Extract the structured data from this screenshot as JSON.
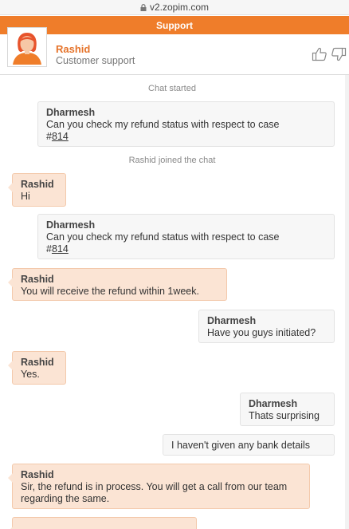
{
  "browser": {
    "url": "v2.zopim.com"
  },
  "header": {
    "title": "Support"
  },
  "agent": {
    "name": "Rashid",
    "role": "Customer support"
  },
  "chat": {
    "system": [
      "Chat started",
      "Rashid joined the chat"
    ],
    "messages": [
      {
        "sender": "Dharmesh",
        "text": "Can you check my refund status with respect to case",
        "line2_prefix": "#",
        "ref": "814"
      },
      {
        "sender": "Rashid",
        "text": "Hi"
      },
      {
        "sender": "Dharmesh",
        "text": "Can you check my refund status with respect to case",
        "line2_prefix": "#",
        "ref": "814"
      },
      {
        "sender": "Rashid",
        "text": "You will receive the refund within 1week."
      },
      {
        "sender": "Dharmesh",
        "text": "Have you guys initiated?"
      },
      {
        "sender": "Rashid",
        "text": "Yes."
      },
      {
        "sender": "Dharmesh",
        "text": "Thats surprising"
      },
      {
        "text": "I haven't given any bank details"
      },
      {
        "sender": "Rashid",
        "text": "Sir, the refund is in process. You will get a call from our team regarding the same."
      }
    ]
  }
}
